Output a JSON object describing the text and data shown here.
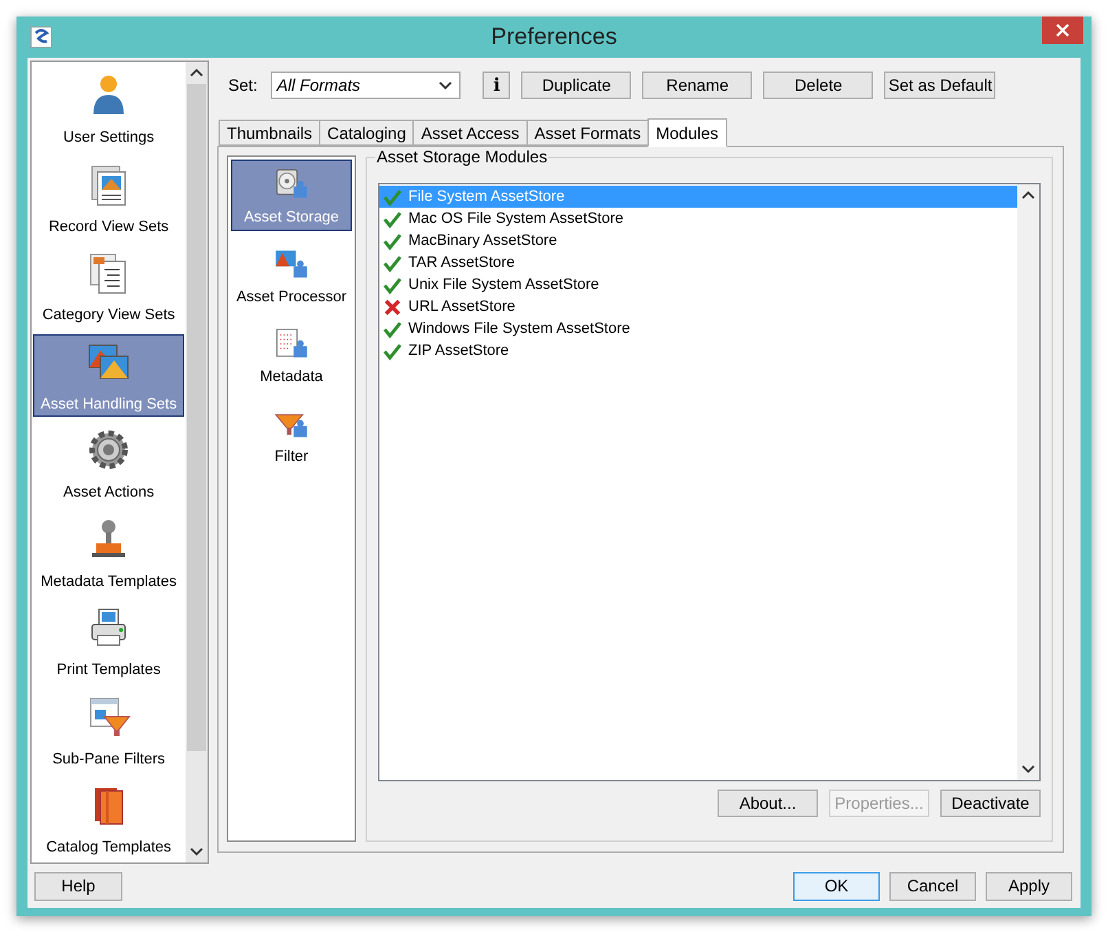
{
  "window": {
    "title": "Preferences"
  },
  "sidebar": {
    "items": [
      {
        "label": "User Settings",
        "selected": false
      },
      {
        "label": "Record View Sets",
        "selected": false
      },
      {
        "label": "Category View Sets",
        "selected": false
      },
      {
        "label": "Asset Handling Sets",
        "selected": true
      },
      {
        "label": "Asset Actions",
        "selected": false
      },
      {
        "label": "Metadata Templates",
        "selected": false
      },
      {
        "label": "Print Templates",
        "selected": false
      },
      {
        "label": "Sub-Pane Filters",
        "selected": false
      },
      {
        "label": "Catalog Templates",
        "selected": false
      }
    ]
  },
  "set": {
    "label": "Set:",
    "value": "All Formats",
    "info": "i",
    "buttons": [
      "Duplicate",
      "Rename",
      "Delete",
      "Set as Default"
    ]
  },
  "tabs": [
    {
      "label": "Thumbnails",
      "selected": false
    },
    {
      "label": "Cataloging",
      "selected": false
    },
    {
      "label": "Asset Access",
      "selected": false
    },
    {
      "label": "Asset Formats",
      "selected": false
    },
    {
      "label": "Modules",
      "selected": true
    }
  ],
  "module_types": [
    {
      "label": "Asset Storage",
      "selected": true
    },
    {
      "label": "Asset Processor",
      "selected": false
    },
    {
      "label": "Metadata",
      "selected": false
    },
    {
      "label": "Filter",
      "selected": false
    }
  ],
  "modules_group": {
    "title": "Asset Storage Modules",
    "items": [
      {
        "label": "File System AssetStore",
        "active": true,
        "selected": true
      },
      {
        "label": "Mac OS File System AssetStore",
        "active": true,
        "selected": false
      },
      {
        "label": "MacBinary AssetStore",
        "active": true,
        "selected": false
      },
      {
        "label": "TAR AssetStore",
        "active": true,
        "selected": false
      },
      {
        "label": "Unix File System AssetStore",
        "active": true,
        "selected": false
      },
      {
        "label": "URL AssetStore",
        "active": false,
        "selected": false
      },
      {
        "label": "Windows File System AssetStore",
        "active": true,
        "selected": false
      },
      {
        "label": "ZIP AssetStore",
        "active": true,
        "selected": false
      }
    ],
    "buttons": [
      {
        "label": "About...",
        "disabled": false
      },
      {
        "label": "Properties...",
        "disabled": true
      },
      {
        "label": "Deactivate",
        "disabled": false
      }
    ]
  },
  "footer": {
    "help": "Help",
    "buttons": [
      {
        "label": "OK",
        "default": true
      },
      {
        "label": "Cancel",
        "default": false
      },
      {
        "label": "Apply",
        "default": false
      }
    ]
  }
}
